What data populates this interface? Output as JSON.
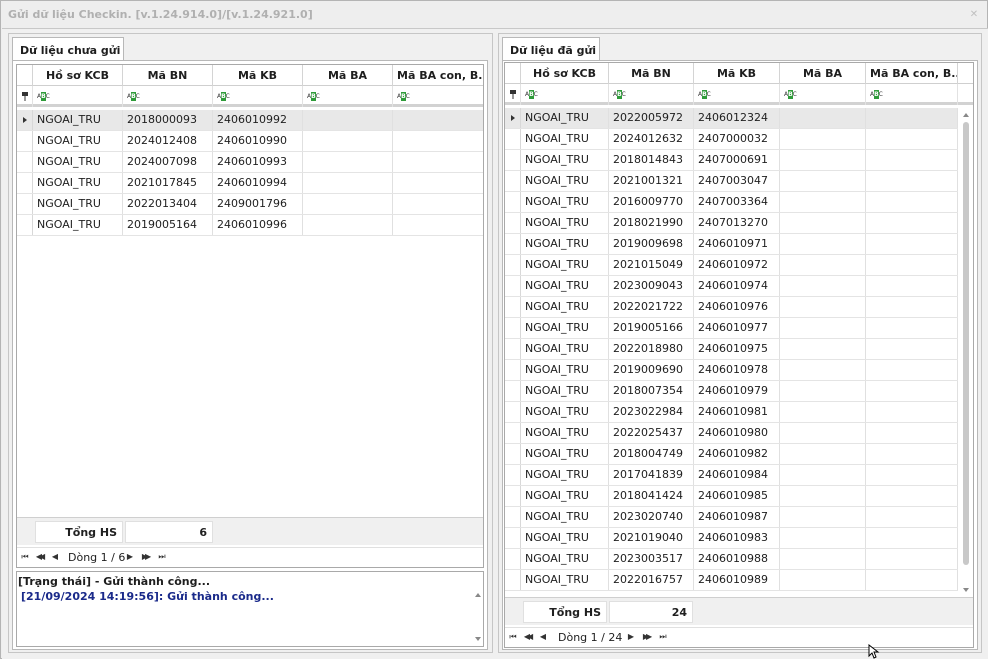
{
  "window": {
    "title": "Gửi dữ liệu Checkin. [v.1.24.914.0]/[v.1.24.921.0]",
    "close_glyph": "✕"
  },
  "columns": [
    "Hồ sơ KCB",
    "Mã BN",
    "Mã KB",
    "Mã BA",
    "Mã BA con, B..."
  ],
  "left_panel": {
    "tab_label": "Dữ liệu chưa gửi",
    "rows": [
      [
        "NGOAI_TRU",
        "2018000093",
        "2406010992",
        "",
        ""
      ],
      [
        "NGOAI_TRU",
        "2024012408",
        "2406010990",
        "",
        ""
      ],
      [
        "NGOAI_TRU",
        "2024007098",
        "2406010993",
        "",
        ""
      ],
      [
        "NGOAI_TRU",
        "2021017845",
        "2406010994",
        "",
        ""
      ],
      [
        "NGOAI_TRU",
        "2022013404",
        "2409001796",
        "",
        ""
      ],
      [
        "NGOAI_TRU",
        "2019005164",
        "2406010996",
        "",
        ""
      ]
    ],
    "footer_label": "Tổng HS",
    "footer_value": "6",
    "nav_text": "Dòng 1 / 6"
  },
  "status": {
    "title": "[Trạng thái] - Gửi thành công...",
    "log": "[21/09/2024 14:19:56]: Gửi thành công..."
  },
  "right_panel": {
    "tab_label": "Dữ liệu đã gửi",
    "rows": [
      [
        "NGOAI_TRU",
        "2022005972",
        "2406012324",
        "",
        ""
      ],
      [
        "NGOAI_TRU",
        "2024012632",
        "2407000032",
        "",
        ""
      ],
      [
        "NGOAI_TRU",
        "2018014843",
        "2407000691",
        "",
        ""
      ],
      [
        "NGOAI_TRU",
        "2021001321",
        "2407003047",
        "",
        ""
      ],
      [
        "NGOAI_TRU",
        "2016009770",
        "2407003364",
        "",
        ""
      ],
      [
        "NGOAI_TRU",
        "2018021990",
        "2407013270",
        "",
        ""
      ],
      [
        "NGOAI_TRU",
        "2019009698",
        "2406010971",
        "",
        ""
      ],
      [
        "NGOAI_TRU",
        "2021015049",
        "2406010972",
        "",
        ""
      ],
      [
        "NGOAI_TRU",
        "2023009043",
        "2406010974",
        "",
        ""
      ],
      [
        "NGOAI_TRU",
        "2022021722",
        "2406010976",
        "",
        ""
      ],
      [
        "NGOAI_TRU",
        "2019005166",
        "2406010977",
        "",
        ""
      ],
      [
        "NGOAI_TRU",
        "2022018980",
        "2406010975",
        "",
        ""
      ],
      [
        "NGOAI_TRU",
        "2019009690",
        "2406010978",
        "",
        ""
      ],
      [
        "NGOAI_TRU",
        "2018007354",
        "2406010979",
        "",
        ""
      ],
      [
        "NGOAI_TRU",
        "2023022984",
        "2406010981",
        "",
        ""
      ],
      [
        "NGOAI_TRU",
        "2022025437",
        "2406010980",
        "",
        ""
      ],
      [
        "NGOAI_TRU",
        "2018004749",
        "2406010982",
        "",
        ""
      ],
      [
        "NGOAI_TRU",
        "2017041839",
        "2406010984",
        "",
        ""
      ],
      [
        "NGOAI_TRU",
        "2018041424",
        "2406010985",
        "",
        ""
      ],
      [
        "NGOAI_TRU",
        "2023020740",
        "2406010987",
        "",
        ""
      ],
      [
        "NGOAI_TRU",
        "2021019040",
        "2406010983",
        "",
        ""
      ],
      [
        "NGOAI_TRU",
        "2023003517",
        "2406010988",
        "",
        ""
      ],
      [
        "NGOAI_TRU",
        "2022016757",
        "2406010989",
        "",
        ""
      ]
    ],
    "footer_label": "Tổng HS",
    "footer_value": "24",
    "nav_text": "Dòng 1 / 24"
  },
  "icons": {
    "nav_first": "⏮",
    "nav_prev_page": "◀◀",
    "nav_prev": "◀",
    "nav_next": "▶",
    "nav_next_page": "▶▶",
    "nav_last": "⏭",
    "filter_abc": "ABC"
  },
  "colors": {
    "background": "#f0f0f0",
    "grid_border": "#a9a9a9",
    "focused_row": "#e8e8e8",
    "status_log": "#1a2a8a",
    "filter_icon_green": "#2f9b3a"
  }
}
